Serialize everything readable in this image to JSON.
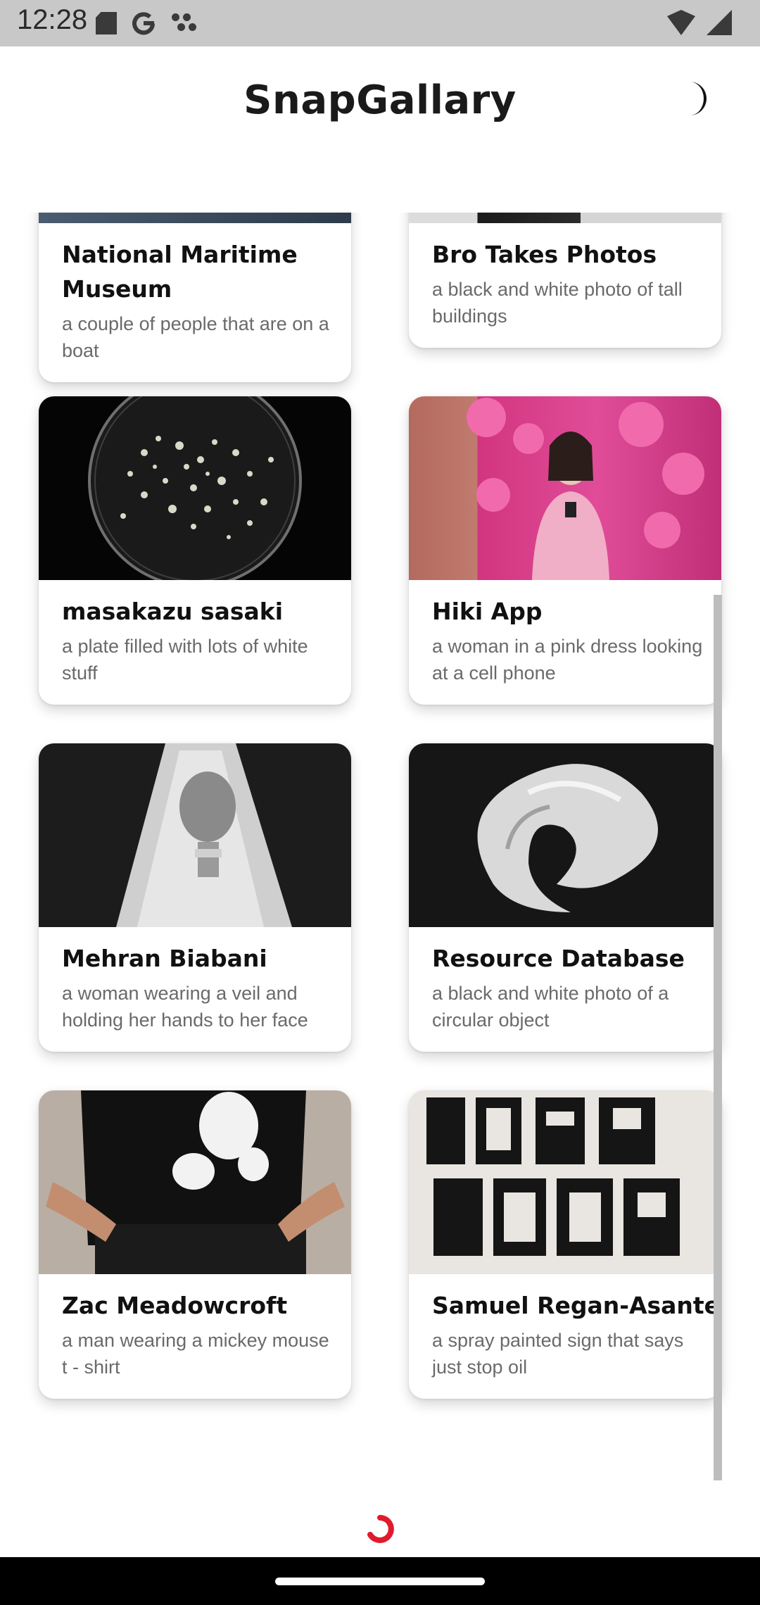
{
  "status_bar": {
    "time": "12:28",
    "icons": [
      "sd-card-icon",
      "google-icon",
      "dots-icon",
      "wifi-icon",
      "signal-icon"
    ]
  },
  "header": {
    "title": "SnapGallary",
    "theme_toggle_icon": "moon-icon"
  },
  "cards": [
    {
      "name": "National Maritime Museum",
      "description": "a couple of people that are on a boat"
    },
    {
      "name": "Bro Takes Photos",
      "description": "a black and white photo of tall buildings"
    },
    {
      "name": "masakazu sasaki",
      "description": "a plate filled with lots of white stuff"
    },
    {
      "name": "Hiki App",
      "description": "a woman in a pink dress looking at a cell phone"
    },
    {
      "name": "Mehran Biabani",
      "description": "a woman wearing a veil and holding her hands to her face"
    },
    {
      "name": "Resource Database",
      "description": "a black and white photo of a circular object"
    },
    {
      "name": "Zac Meadowcroft",
      "description": "a man wearing a mickey mouse t - shirt"
    },
    {
      "name": "Samuel Regan-Asante",
      "description": "a spray painted sign that says just stop oil"
    }
  ],
  "footer": {
    "loader_icon": "loading-spinner-icon",
    "accent": "#e01b2c"
  },
  "colors": {
    "status_bar": "#c8c8c8",
    "background": "#ffffff",
    "title": "#1a1a1a",
    "description": "#6a6a6a"
  }
}
